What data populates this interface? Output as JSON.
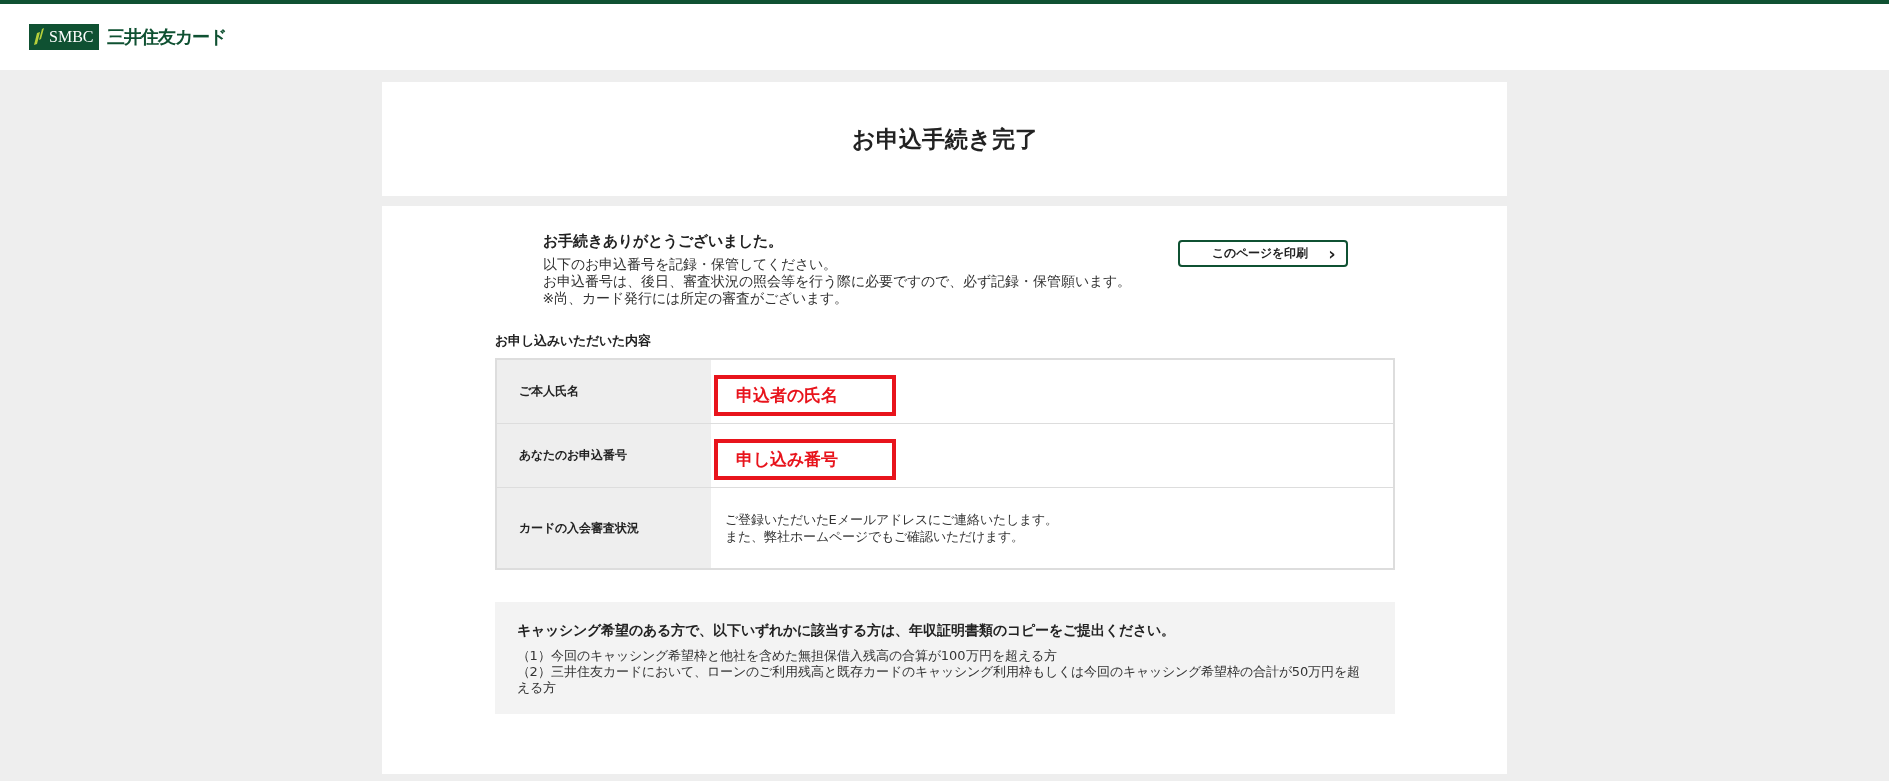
{
  "header": {
    "logo_mark": "SMBC",
    "logo_name": "三井住友カード"
  },
  "page_title": "お申込手続き完了",
  "thanks": {
    "heading": "お手続きありがとうございました。",
    "lines": [
      "以下のお申込番号を記録・保管してください。",
      "お申込番号は、後日、審査状況の照会等を行う際に必要ですので、必ず記録・保管願います。",
      "※尚、カード発行には所定の審査がございます。"
    ]
  },
  "print_button": {
    "label": "このページを印刷",
    "icon": "›"
  },
  "details": {
    "title": "お申し込みいただいた内容",
    "rows": [
      {
        "label": "ご本人氏名",
        "kind": "highlight",
        "value": [
          "申込者の氏名"
        ]
      },
      {
        "label": "あなたのお申込番号",
        "kind": "highlight",
        "value": [
          "申し込み番号"
        ]
      },
      {
        "label": "カードの入会審査状況",
        "kind": "plain",
        "value": [
          "ご登録いただいたEメールアドレスにご連絡いたします。",
          "また、弊社ホームページでもご確認いただけます。"
        ]
      }
    ]
  },
  "notice": {
    "heading": "キャッシング希望のある方で、以下いずれかに該当する方は、年収証明書類のコピーをご提出ください。",
    "items": [
      "（1）今回のキャッシング希望枠と他社を含めた無担保借入残高の合算が100万円を超える方",
      "（2）三井住友カードにおいて、ローンのご利用残高と既存カードのキャッシング利用枠もしくは今回のキャッシング希望枠の合計が50万円を超える方"
    ]
  }
}
